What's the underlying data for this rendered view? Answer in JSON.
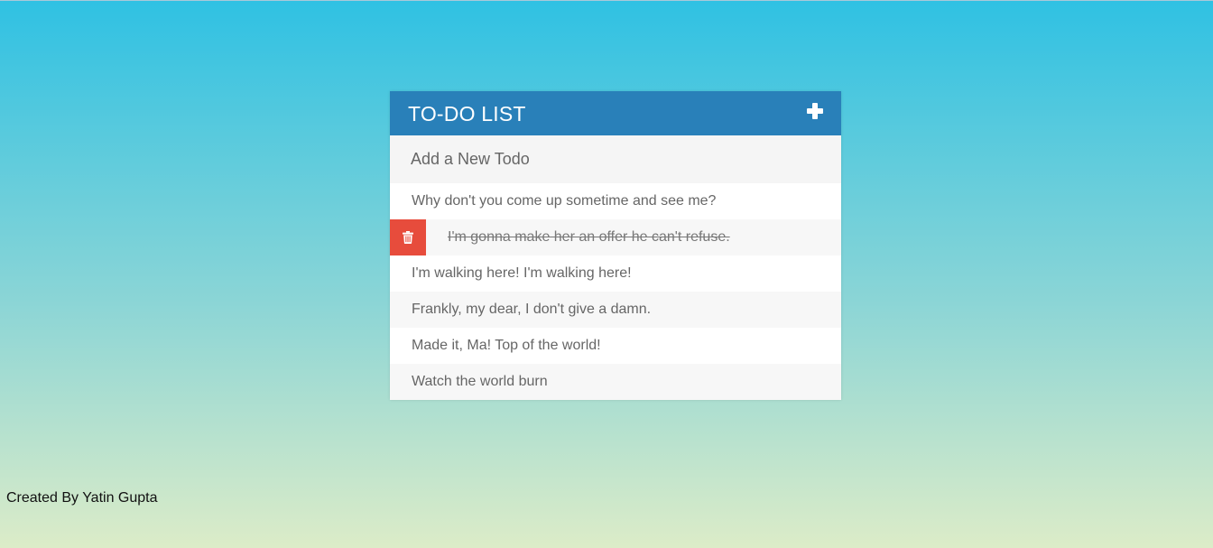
{
  "header": {
    "title": "TO-DO LIST",
    "add_icon": "plus-icon"
  },
  "new_todo": {
    "placeholder": "Add a New Todo",
    "value": ""
  },
  "todos": [
    {
      "text": "Why don't you come up sometime and see me?",
      "completed": false
    },
    {
      "text": "I'm gonna make her an offer he can't refuse.",
      "completed": true,
      "delete_visible": true,
      "delete_icon": "trash-icon"
    },
    {
      "text": "I'm walking here! I'm walking here!",
      "completed": false
    },
    {
      "text": "Frankly, my dear, I don't give a damn.",
      "completed": false
    },
    {
      "text": "Made it, Ma! Top of the world!",
      "completed": false
    },
    {
      "text": "Watch the world burn",
      "completed": false
    }
  ],
  "footer": {
    "credit": "Created By Yatin Gupta"
  },
  "colors": {
    "header_bg": "#2980b9",
    "delete_bg": "#e74c3c",
    "gradient_top": "#2fc1e3",
    "gradient_bottom": "#dcecc8"
  }
}
